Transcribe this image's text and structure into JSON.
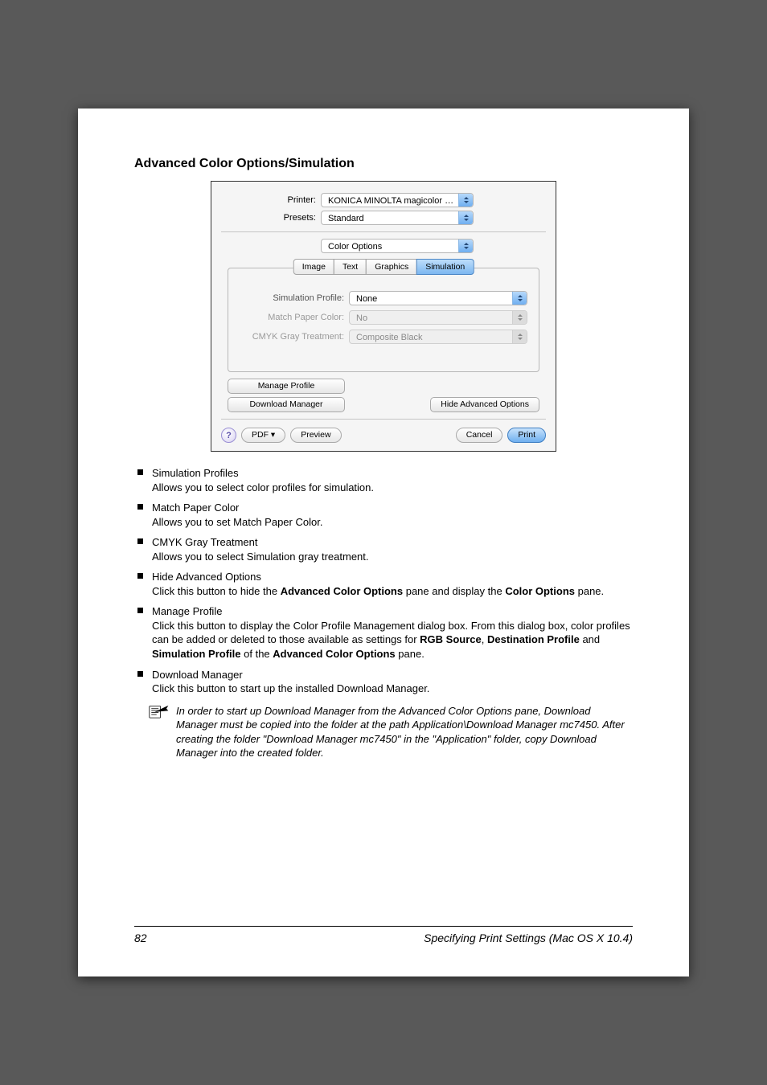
{
  "heading": "Advanced Color Options/Simulation",
  "dialog": {
    "printer_label": "Printer:",
    "printer_value": "KONICA MINOLTA magicolor …",
    "presets_label": "Presets:",
    "presets_value": "Standard",
    "section_value": "Color Options",
    "tabs": {
      "image": "Image",
      "text": "Text",
      "graphics": "Graphics",
      "simulation": "Simulation"
    },
    "sim_profile_label": "Simulation Profile:",
    "sim_profile_value": "None",
    "match_paper_label": "Match Paper Color:",
    "match_paper_value": "No",
    "cmyk_gray_label": "CMYK Gray Treatment:",
    "cmyk_gray_value": "Composite Black",
    "manage_profile_btn": "Manage Profile",
    "download_manager_btn": "Download Manager",
    "hide_adv_btn": "Hide Advanced Options",
    "help_glyph": "?",
    "pdf_btn": "PDF ▾",
    "preview_btn": "Preview",
    "cancel_btn": "Cancel",
    "print_btn": "Print"
  },
  "bullets": [
    {
      "title": "Simulation Profiles",
      "desc": "Allows you to select color profiles for simulation."
    },
    {
      "title": "Match Paper Color",
      "desc": "Allows you to set Match Paper Color."
    },
    {
      "title": "CMYK Gray Treatment",
      "desc": "Allows you to select Simulation gray treatment."
    },
    {
      "title": "Hide Advanced Options",
      "desc_pre": "Click this button to hide the ",
      "bold1": "Advanced Color Options",
      "desc_mid": " pane and display the ",
      "bold2": "Color Options",
      "desc_post": " pane."
    },
    {
      "title": "Manage Profile",
      "mp_pre": "Click this button to display the Color Profile Management dialog box. From this dialog box, color profiles can be added or deleted to those available as settings for ",
      "mp_b1": "RGB Source",
      "mp_c1": ", ",
      "mp_b2": "Destination Profile",
      "mp_c2": " and ",
      "mp_b3": "Simulation Profile",
      "mp_c3": " of the ",
      "mp_b4": "Advanced Color Options",
      "mp_post": " pane."
    },
    {
      "title": "Download Manager",
      "desc": "Click this button to start up the installed Download Manager."
    }
  ],
  "note": "In order to start up Download Manager from the Advanced Color Options pane, Download Manager must be copied into the folder at the path Application\\Download Manager mc7450. After creating the folder \"Download Manager mc7450\" in the \"Application\" folder, copy Download Manager into the created folder.",
  "footer": {
    "page": "82",
    "title": "Specifying Print Settings (Mac OS X 10.4)"
  }
}
